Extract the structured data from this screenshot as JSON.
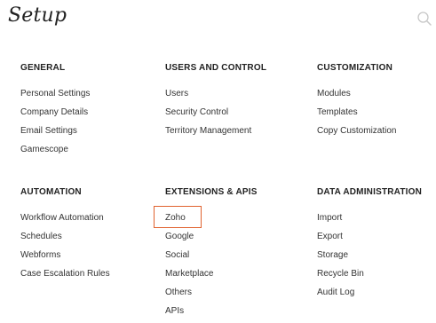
{
  "page": {
    "title": "Setup",
    "search_icon": "search-icon"
  },
  "sections": {
    "general": {
      "heading": "GENERAL",
      "items": [
        "Personal Settings",
        "Company Details",
        "Email Settings",
        "Gamescope"
      ]
    },
    "users_and_control": {
      "heading": "USERS AND CONTROL",
      "items": [
        "Users",
        "Security Control",
        "Territory Management"
      ]
    },
    "customization": {
      "heading": "CUSTOMIZATION",
      "items": [
        "Modules",
        "Templates",
        "Copy Customization"
      ]
    },
    "automation": {
      "heading": "AUTOMATION",
      "items": [
        "Workflow Automation",
        "Schedules",
        "Webforms",
        "Case Escalation Rules"
      ]
    },
    "extensions_apis": {
      "heading": "EXTENSIONS & APIS",
      "items": [
        "Zoho",
        "Google",
        "Social",
        "Marketplace",
        "Others",
        "APIs"
      ]
    },
    "data_administration": {
      "heading": "DATA ADMINISTRATION",
      "items": [
        "Import",
        "Export",
        "Storage",
        "Recycle Bin",
        "Audit Log"
      ]
    }
  },
  "colors": {
    "highlight": "#e0622f",
    "text": "#333333",
    "heading": "#222222"
  }
}
